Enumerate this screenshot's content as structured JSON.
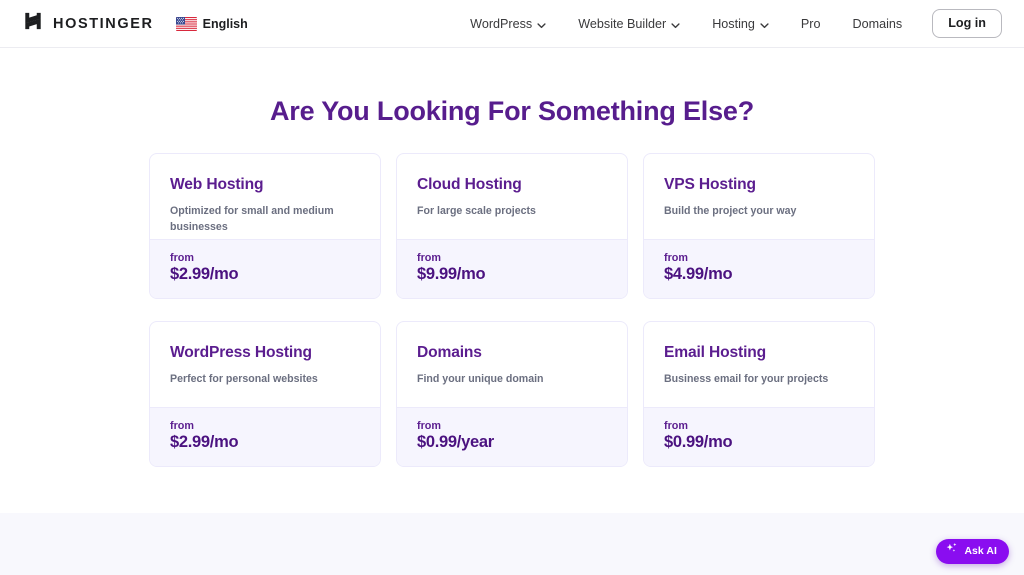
{
  "header": {
    "logo": {
      "icon": "hostinger-h-logo-icon",
      "wordmark": "HOSTINGER"
    },
    "language": {
      "icon": "us-flag-icon",
      "label": "English"
    },
    "nav_items": [
      {
        "label": "WordPress",
        "has_dropdown": true,
        "icon": "chevron-down-icon"
      },
      {
        "label": "Website Builder",
        "has_dropdown": true,
        "icon": "chevron-down-icon"
      },
      {
        "label": "Hosting",
        "has_dropdown": true,
        "icon": "chevron-down-icon"
      },
      {
        "label": "Pro",
        "has_dropdown": false
      },
      {
        "label": "Domains",
        "has_dropdown": false
      }
    ],
    "login_label": "Log in"
  },
  "main": {
    "title": "Are You Looking For Something Else?",
    "from_label": "from",
    "cards": [
      {
        "title": "Web Hosting",
        "description": "Optimized for small and medium businesses",
        "from_label": "from",
        "price": "$2.99/mo"
      },
      {
        "title": "Cloud Hosting",
        "description": "For large scale projects",
        "from_label": "from",
        "price": "$9.99/mo"
      },
      {
        "title": "VPS Hosting",
        "description": "Build the project your way",
        "from_label": "from",
        "price": "$4.99/mo"
      },
      {
        "title": "WordPress Hosting",
        "description": "Perfect for personal websites",
        "from_label": "from",
        "price": "$2.99/mo"
      },
      {
        "title": "Domains",
        "description": "Find your unique domain",
        "from_label": "from",
        "price": "$0.99/year"
      },
      {
        "title": "Email Hosting",
        "description": "Business email for your projects",
        "from_label": "from",
        "price": "$0.99/mo"
      }
    ]
  },
  "ask_ai": {
    "label": "Ask AI",
    "icon": "sparkle-icon"
  },
  "colors": {
    "brand_purple": "#5b1d8f",
    "price_purple": "#4b1280",
    "card_footer_bg": "#f6f5fe",
    "card_border": "#eceafb",
    "ask_ai_bg": "#8a0df0",
    "body_text": "#6b6f80",
    "bottom_band_bg": "#f8f8fd"
  }
}
